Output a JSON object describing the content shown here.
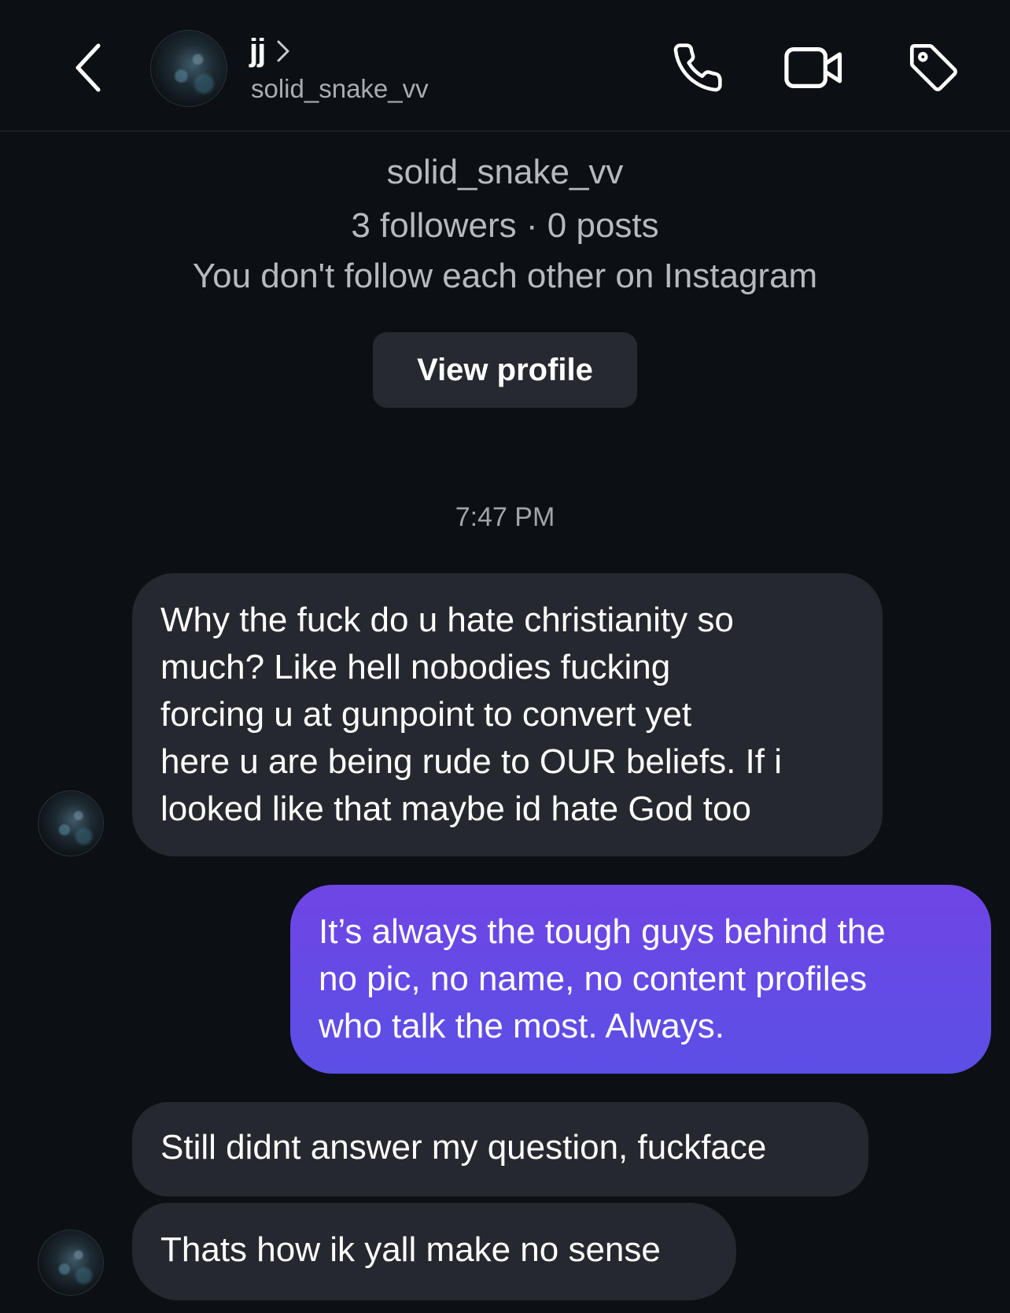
{
  "header": {
    "display_name": "jj",
    "username": "solid_snake_vv",
    "icons": {
      "back": "chevron-left-icon",
      "chevron": "chevron-right-icon",
      "call": "phone-icon",
      "video": "video-camera-icon",
      "tag": "tag-icon"
    }
  },
  "profile": {
    "username": "solid_snake_vv",
    "stats": "3 followers · 0 posts",
    "follow_status": "You don't follow each other on Instagram",
    "view_profile_label": "View profile"
  },
  "conversation": {
    "timestamp": "7:47 PM",
    "messages": [
      {
        "direction": "incoming",
        "lines": [
          "Why the fuck do u hate christianity so",
          "much? Like hell nobodies fucking",
          "forcing u at gunpoint to convert yet",
          "here u are being rude to OUR beliefs. If i",
          "looked like that maybe id hate God too"
        ]
      },
      {
        "direction": "outgoing",
        "lines": [
          "It’s always the tough guys behind the",
          "no pic, no name, no content profiles",
          "who talk the most. Always."
        ]
      },
      {
        "direction": "incoming",
        "lines": [
          "Still didnt answer my question, fuckface"
        ]
      },
      {
        "direction": "incoming",
        "lines": [
          "Thats how ik yall make no sense"
        ]
      }
    ]
  },
  "colors": {
    "background": "#0c0f14",
    "incoming_bubble": "#25282e",
    "outgoing_bubble_top": "#6f45e5",
    "outgoing_bubble_bottom": "#5b4fe6",
    "secondary_text": "#b5bac1"
  }
}
